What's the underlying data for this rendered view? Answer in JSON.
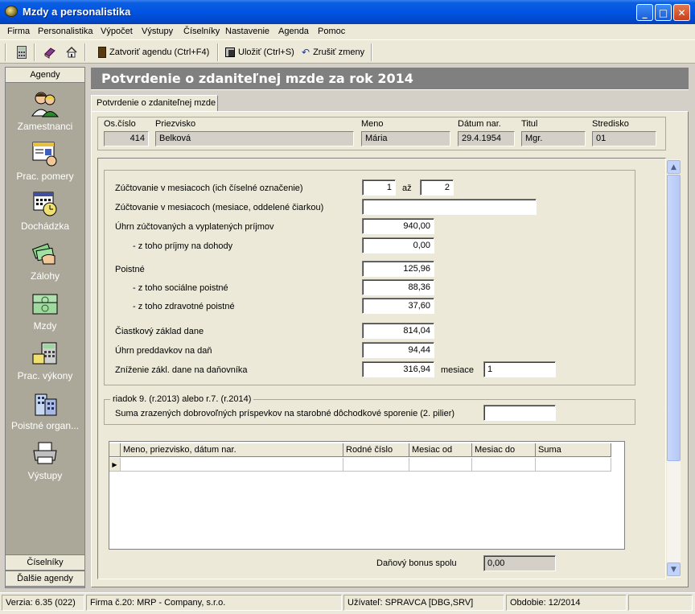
{
  "window": {
    "title": "Mzdy a personalistika"
  },
  "menu": [
    "Firma",
    "Personalistika",
    "Výpočet",
    "Výstupy",
    "Číselníky",
    "Nastavenie",
    "Agenda",
    "Pomoc"
  ],
  "toolbar": {
    "close_agenda": "Zatvoriť agendu (Ctrl+F4)",
    "save": "Uložiť (Ctrl+S)",
    "cancel_changes": "Zrušiť zmeny"
  },
  "sidebar": {
    "header": "Agendy",
    "items": [
      {
        "label": "Zamestnanci",
        "icon": "employees-icon"
      },
      {
        "label": "Prac. pomery",
        "icon": "work-relations-icon"
      },
      {
        "label": "Dochádzka",
        "icon": "attendance-icon"
      },
      {
        "label": "Zálohy",
        "icon": "advances-icon"
      },
      {
        "label": "Mzdy",
        "icon": "wages-icon"
      },
      {
        "label": "Prac. výkony",
        "icon": "work-output-icon"
      },
      {
        "label": "Poistné organ...",
        "icon": "insurance-org-icon"
      },
      {
        "label": "Výstupy",
        "icon": "outputs-icon"
      }
    ],
    "footer": [
      "Číselníky",
      "Ďalšie agendy"
    ]
  },
  "main": {
    "title": "Potvrdenie o zdaniteľnej mzde za rok 2014",
    "tab": "Potvrdenie o zdaniteľnej mzde"
  },
  "employee": {
    "labels": {
      "number": "Os.číslo",
      "surname": "Priezvisko",
      "name": "Meno",
      "birth": "Dátum nar.",
      "title": "Titul",
      "center": "Stredisko"
    },
    "values": {
      "number": "414",
      "surname": "Belková",
      "name": "Mária",
      "birth": "29.4.1954",
      "title": "Mgr.",
      "center": "01"
    }
  },
  "form": {
    "months_label": "Zúčtovanie v mesiacoch (ich číselné označenie)",
    "months_from": "1",
    "months_to_label": "až",
    "months_to": "2",
    "months_list_label": "Zúčtovanie v mesiacoch (mesiace, oddelené čiarkou)",
    "months_list": "",
    "income_label": "Úhrn zúčtovaných a vyplatených príjmov",
    "income": "940,00",
    "income_agreements_label": "- z toho príjmy na dohody",
    "income_agreements": "0,00",
    "insurance_label": "Poistné",
    "insurance": "125,96",
    "social_label": "- z toho sociálne poistné",
    "social": "88,36",
    "health_label": "- z toho zdravotné  poistné",
    "health": "37,60",
    "tax_base_label": "Čiastkový základ dane",
    "tax_base": "814,04",
    "advances_label": "Úhrn preddavkov na daň",
    "advances": "94,44",
    "reduction_label": "Zníženie zákl. dane na daňovníka",
    "reduction": "316,94",
    "reduction_months_label": "mesiace",
    "reduction_months": "1"
  },
  "pension": {
    "legend": "riadok 9. (r.2013) alebo r.7. (r.2014)",
    "label": "Suma zrazených dobrovoľných príspevkov na starobné dôchodkové sporenie (2. pilier)",
    "value": ""
  },
  "grid": {
    "columns": [
      "Meno, priezvisko, dátum nar.",
      "Rodné číslo",
      "Mesiac od",
      "Mesiac do",
      "Suma"
    ]
  },
  "bonus": {
    "label": "Daňový bonus spolu",
    "value": "0,00"
  },
  "status": {
    "version": "Verzia: 6.35 (022)",
    "company": "Firma č.20: MRP - Company, s.r.o.",
    "user": "Užívateľ: SPRAVCA [DBG,SRV]",
    "period": "Obdobie: 12/2014"
  }
}
